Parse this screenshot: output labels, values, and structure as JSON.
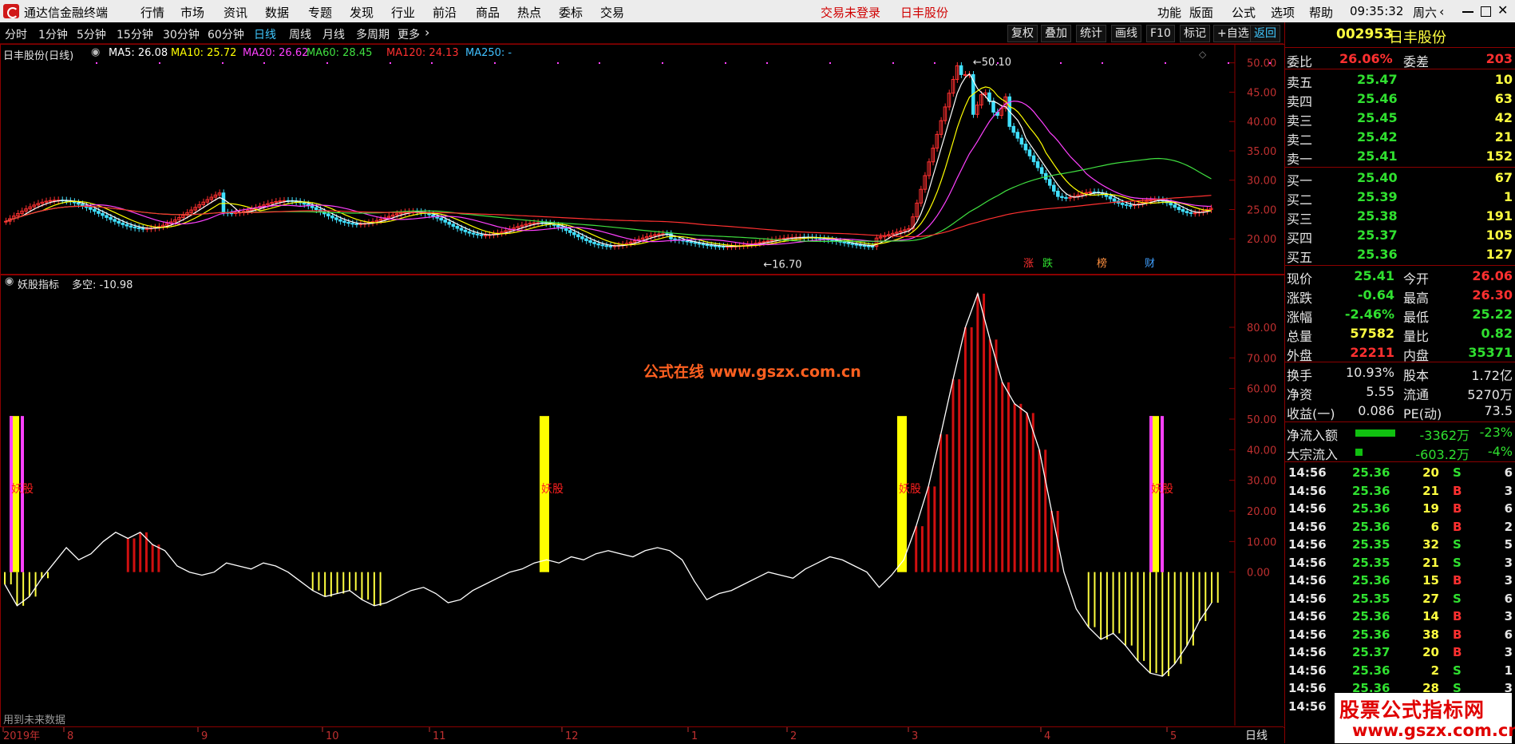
{
  "app": {
    "title": "通达信金融终端",
    "menus": [
      "行情",
      "市场",
      "资讯",
      "数据",
      "专题",
      "发现",
      "行业",
      "前沿",
      "商品",
      "热点",
      "委标",
      "交易"
    ],
    "login_status": "交易未登录",
    "stock_title": "日丰股份",
    "right_menus": [
      "功能",
      "版面",
      "公式",
      "选项",
      "帮助"
    ],
    "clock": "09:35:32",
    "weekday": "周六"
  },
  "toolbar": {
    "periods": [
      "分时",
      "1分钟",
      "5分钟",
      "15分钟",
      "30分钟",
      "60分钟",
      "日线",
      "周线",
      "月线",
      "多周期",
      "更多"
    ],
    "active_period": "日线",
    "right_buttons": [
      "复权",
      "叠加",
      "统计",
      "画线",
      "F10",
      "标记",
      "+自选",
      "返回"
    ]
  },
  "main_chart": {
    "name": "日丰股份(日线)",
    "ma": [
      {
        "label": "MA5: 26.08",
        "color": "#ffffff"
      },
      {
        "label": "MA10: 25.72",
        "color": "#ffff00"
      },
      {
        "label": "MA20: 26.62",
        "color": "#ff40ff"
      },
      {
        "label": "MA60: 28.45",
        "color": "#40e040"
      },
      {
        "label": "MA120: 24.13",
        "color": "#ff3030"
      },
      {
        "label": "MA250: -",
        "color": "#40c0ff"
      }
    ],
    "y_ticks": [
      "50.00",
      "45.00",
      "40.00",
      "35.00",
      "30.00",
      "25.00",
      "20.00"
    ],
    "high_label": "50.10",
    "low_label": "16.70",
    "tags": [
      {
        "text": "涨",
        "color": "#ff3030"
      },
      {
        "text": "跌",
        "color": "#30e030"
      },
      {
        "text": "榜",
        "color": "#ff9040"
      },
      {
        "text": "财",
        "color": "#40a0ff"
      }
    ]
  },
  "indicator_chart": {
    "name": "妖股指标",
    "value": "多空: -10.98",
    "watermark": "公式在线  www.gszx.com.cn",
    "signal_label": "妖股",
    "y_ticks": [
      "80.00",
      "70.00",
      "60.00",
      "50.00",
      "40.00",
      "30.00",
      "20.00",
      "10.00",
      "0.00"
    ],
    "footer": "用到未来数据"
  },
  "x_axis": {
    "labels": [
      "2019年",
      "8",
      "9",
      "10",
      "11",
      "12",
      "1",
      "2",
      "3",
      "4",
      "5"
    ],
    "period_label": "日线"
  },
  "chart_data": {
    "type": "line",
    "series": [
      {
        "values": [
          -4,
          -11,
          -8,
          -2,
          3,
          8,
          4,
          6,
          10,
          13,
          11,
          13,
          9,
          7,
          2,
          0,
          -1,
          0,
          3,
          2,
          1,
          3,
          2,
          0,
          -3,
          -6,
          -8,
          -7,
          -6,
          -9,
          -11,
          -10,
          -8,
          -6,
          -5,
          -7,
          -10,
          -9,
          -6,
          -4,
          -2,
          0,
          1,
          3,
          4,
          3,
          5,
          4,
          6,
          7,
          6,
          5,
          7,
          8,
          7,
          4,
          -3,
          -9,
          -7,
          -6,
          -4,
          -2,
          0,
          -1,
          -2,
          1,
          3,
          5,
          4,
          2,
          0,
          -5,
          -1,
          4,
          15,
          28,
          45,
          63,
          80,
          91,
          76,
          62,
          55,
          52,
          40,
          20,
          0,
          -12,
          -18,
          -22,
          -20,
          -24,
          -29,
          -33,
          -34,
          -30,
          -24,
          -16,
          -10
        ]
      }
    ]
  },
  "order_book": {
    "code": "002953",
    "name": "日丰股份",
    "wei_bi_label": "委比",
    "wei_bi": "26.06%",
    "wei_cha_label": "委差",
    "wei_cha": "203",
    "sells": [
      {
        "label": "卖五",
        "price": "25.47",
        "vol": "10"
      },
      {
        "label": "卖四",
        "price": "25.46",
        "vol": "63"
      },
      {
        "label": "卖三",
        "price": "25.45",
        "vol": "42"
      },
      {
        "label": "卖二",
        "price": "25.42",
        "vol": "21"
      },
      {
        "label": "卖一",
        "price": "25.41",
        "vol": "152"
      }
    ],
    "buys": [
      {
        "label": "买一",
        "price": "25.40",
        "vol": "67"
      },
      {
        "label": "买二",
        "price": "25.39",
        "vol": "1"
      },
      {
        "label": "买三",
        "price": "25.38",
        "vol": "191"
      },
      {
        "label": "买四",
        "price": "25.37",
        "vol": "105"
      },
      {
        "label": "买五",
        "price": "25.36",
        "vol": "127"
      }
    ],
    "quote": [
      {
        "l1": "现价",
        "v1": "25.41",
        "c1": "#30e030",
        "l2": "今开",
        "v2": "26.06",
        "c2": "#ff3030"
      },
      {
        "l1": "涨跌",
        "v1": "-0.64",
        "c1": "#30e030",
        "l2": "最高",
        "v2": "26.30",
        "c2": "#ff3030"
      },
      {
        "l1": "涨幅",
        "v1": "-2.46%",
        "c1": "#30e030",
        "l2": "最低",
        "v2": "25.22",
        "c2": "#30e030"
      },
      {
        "l1": "总量",
        "v1": "57582",
        "c1": "#ffff40",
        "l2": "量比",
        "v2": "0.82",
        "c2": "#30e030"
      },
      {
        "l1": "外盘",
        "v1": "22211",
        "c1": "#ff3030",
        "l2": "内盘",
        "v2": "35371",
        "c2": "#30e030"
      }
    ],
    "fund": [
      {
        "l1": "换手",
        "v1": "10.93%",
        "l2": "股本",
        "v2": "1.72亿"
      },
      {
        "l1": "净资",
        "v1": "5.55",
        "l2": "流通",
        "v2": "5270万"
      },
      {
        "l1": "收益(一)",
        "v1": "0.086",
        "l2": "PE(动)",
        "v2": "73.5"
      }
    ],
    "flow": [
      {
        "label": "净流入额",
        "value": "-3362万",
        "pct": "-23%",
        "bar": 0.77
      },
      {
        "label": "大宗流入",
        "value": "-603.2万",
        "pct": "-4%",
        "bar": 0.08
      }
    ],
    "ticks": [
      {
        "time": "14:56",
        "price": "25.36",
        "vol": "20",
        "bs": "S",
        "n": "6"
      },
      {
        "time": "14:56",
        "price": "25.36",
        "vol": "21",
        "bs": "B",
        "n": "3"
      },
      {
        "time": "14:56",
        "price": "25.36",
        "vol": "19",
        "bs": "B",
        "n": "6"
      },
      {
        "time": "14:56",
        "price": "25.36",
        "vol": "6",
        "bs": "B",
        "n": "2"
      },
      {
        "time": "14:56",
        "price": "25.35",
        "vol": "32",
        "bs": "S",
        "n": "5"
      },
      {
        "time": "14:56",
        "price": "25.35",
        "vol": "21",
        "bs": "S",
        "n": "3"
      },
      {
        "time": "14:56",
        "price": "25.36",
        "vol": "15",
        "bs": "B",
        "n": "3"
      },
      {
        "time": "14:56",
        "price": "25.35",
        "vol": "27",
        "bs": "S",
        "n": "6"
      },
      {
        "time": "14:56",
        "price": "25.36",
        "vol": "14",
        "bs": "B",
        "n": "3"
      },
      {
        "time": "14:56",
        "price": "25.36",
        "vol": "38",
        "bs": "B",
        "n": "6"
      },
      {
        "time": "14:56",
        "price": "25.37",
        "vol": "20",
        "bs": "B",
        "n": "3"
      },
      {
        "time": "14:56",
        "price": "25.36",
        "vol": "2",
        "bs": "S",
        "n": "1"
      },
      {
        "time": "14:56",
        "price": "25.36",
        "vol": "28",
        "bs": "S",
        "n": "3"
      },
      {
        "time": "14:56",
        "price": "25.36",
        "vol": "",
        "bs": "",
        "n": ""
      }
    ]
  },
  "watermark_badge": {
    "title": "股票公式指标网",
    "url": "www.gszx.com.cn"
  }
}
